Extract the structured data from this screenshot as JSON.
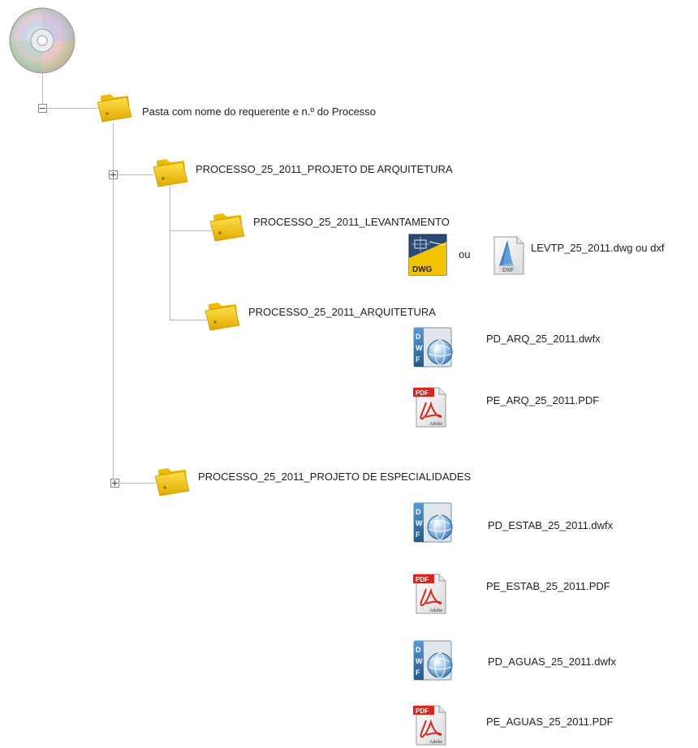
{
  "tree": {
    "root": {
      "icon": "cd-disc-icon",
      "toggle": "minus",
      "folder_icon": "folder-icon",
      "label": "Pasta com nome do requerente e n.º do Processo"
    },
    "projeto_arquitetura": {
      "toggle": "plus",
      "label": "PROCESSO_25_2011_PROJETO DE ARQUITETURA",
      "levantamento": {
        "label": "PROCESSO_25_2011_LEVANTAMENTO",
        "files": {
          "dwg_badge": "DWG",
          "or_text": "ou",
          "dxf_badge": "DXF",
          "name": "LEVTP_25_2011.dwg ou dxf"
        }
      },
      "arquitetura": {
        "label": "PROCESSO_25_2011_ARQUITETURA",
        "files": [
          {
            "name": "PD_ARQ_25_2011.dwfx",
            "type": "dwfx"
          },
          {
            "name": "PE_ARQ_25_2011.PDF",
            "type": "pdf"
          }
        ]
      }
    },
    "projeto_especialidades": {
      "toggle": "plus",
      "label": "PROCESSO_25_2011_PROJETO DE ESPECIALIDADES",
      "files": [
        {
          "name": "PD_ESTAB_25_2011.dwfx",
          "type": "dwfx"
        },
        {
          "name": "PE_ESTAB_25_2011.PDF",
          "type": "pdf"
        },
        {
          "name": "PD_AGUAS_25_2011.dwfx",
          "type": "dwfx"
        },
        {
          "name": "PE_AGUAS_25_2011.PDF",
          "type": "pdf"
        }
      ]
    }
  },
  "icon_text": {
    "pdf_badge": "PDF",
    "adobe": "Adobe",
    "dwf_letters": [
      "D",
      "W",
      "F"
    ]
  },
  "colors": {
    "folder": "#f2c200",
    "folder_dark": "#d19a00",
    "tree_line": "#b9b9b9",
    "pdf_red": "#d7261f",
    "dwf_blue": "#2f6fa8"
  }
}
